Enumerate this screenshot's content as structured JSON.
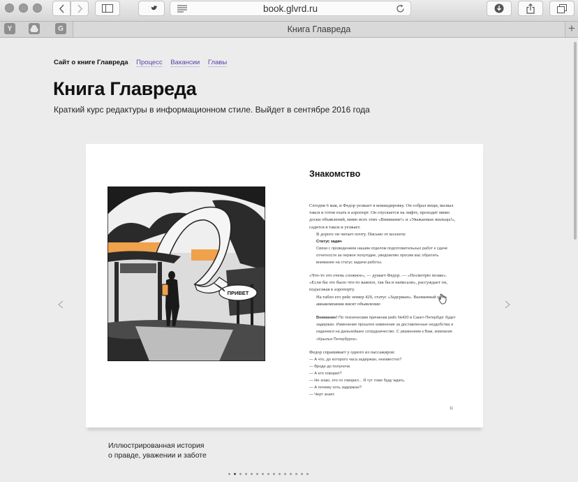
{
  "browser": {
    "url": "book.glvrd.ru",
    "tab_title": "Книга Главреда",
    "favicons": [
      "Y",
      "",
      "G"
    ],
    "new_tab_symbol": "+"
  },
  "page": {
    "nav": {
      "site": "Сайт о книге Главреда",
      "links": [
        "Процесс",
        "Вакансии",
        "Главы"
      ]
    },
    "title": "Книга Главреда",
    "subtitle": "Краткий курс редактуры в информационном стиле. Выйдет в сентябре 2016 года",
    "book_spread": {
      "speech_bubble": "ПРИВЕТ",
      "chapter_title": "Знакомство",
      "para1": "Сегодня 6 мая, и Федор уезжает в командировку. Он собрал вещи, вызвал такси и готов ехать в аэропорт. Он спускается на лифте, проходит мимо доски объявлений, мимо всех этих «Внимание!» и «Уважаемые жильцы!», садится в такси и уезжает.",
      "para2": "В дороге он читает почту. Письмо от коллеги:",
      "email_heading": "Статус задач",
      "email_body": "Связи с проведением нашим отделом подготовительных работ к сдаче отчетности за первое полугодие, уведомляю просим вас обратить внимание на статус задачи работы.",
      "para3": "«Что-то это очень сложное», — думает Федор. — «Посмотрю позже». «Если бы это было что-то важное, так бы и написали», рассуждает он, подъезжая к аэропорту.",
      "para4": "На табло его рейс номер 420, статус «Задержан». Вызванный на авиакомпании висит объявление:",
      "notice_lead": "Внимание!",
      "notice_body": "По техническим причинам рейс №420 в Санкт-Петербург будет задержан. Изменение прошлое извинение за доставленные неудобства и надеемся на дальнейшее сотрудничество. С уважением к Вам, компания «Крылья Петербурга».",
      "para5": "Федор спрашивает у одного из пассажиров:",
      "dialog": [
        "— А что, до которого часа задержан, неизвестно?",
        "— Вроде до полуночи.",
        "— А кто говорил?",
        "— Не знаю, кто-то говорил... Я тут тоже буду ждать.",
        "— А почему хоть задержан?",
        "— Черт знает."
      ],
      "page_number": "11"
    },
    "tagline": [
      "Иллюстрированная история",
      "о правде, уважении и заботе"
    ],
    "pager": {
      "count": 15,
      "active": 1
    }
  }
}
